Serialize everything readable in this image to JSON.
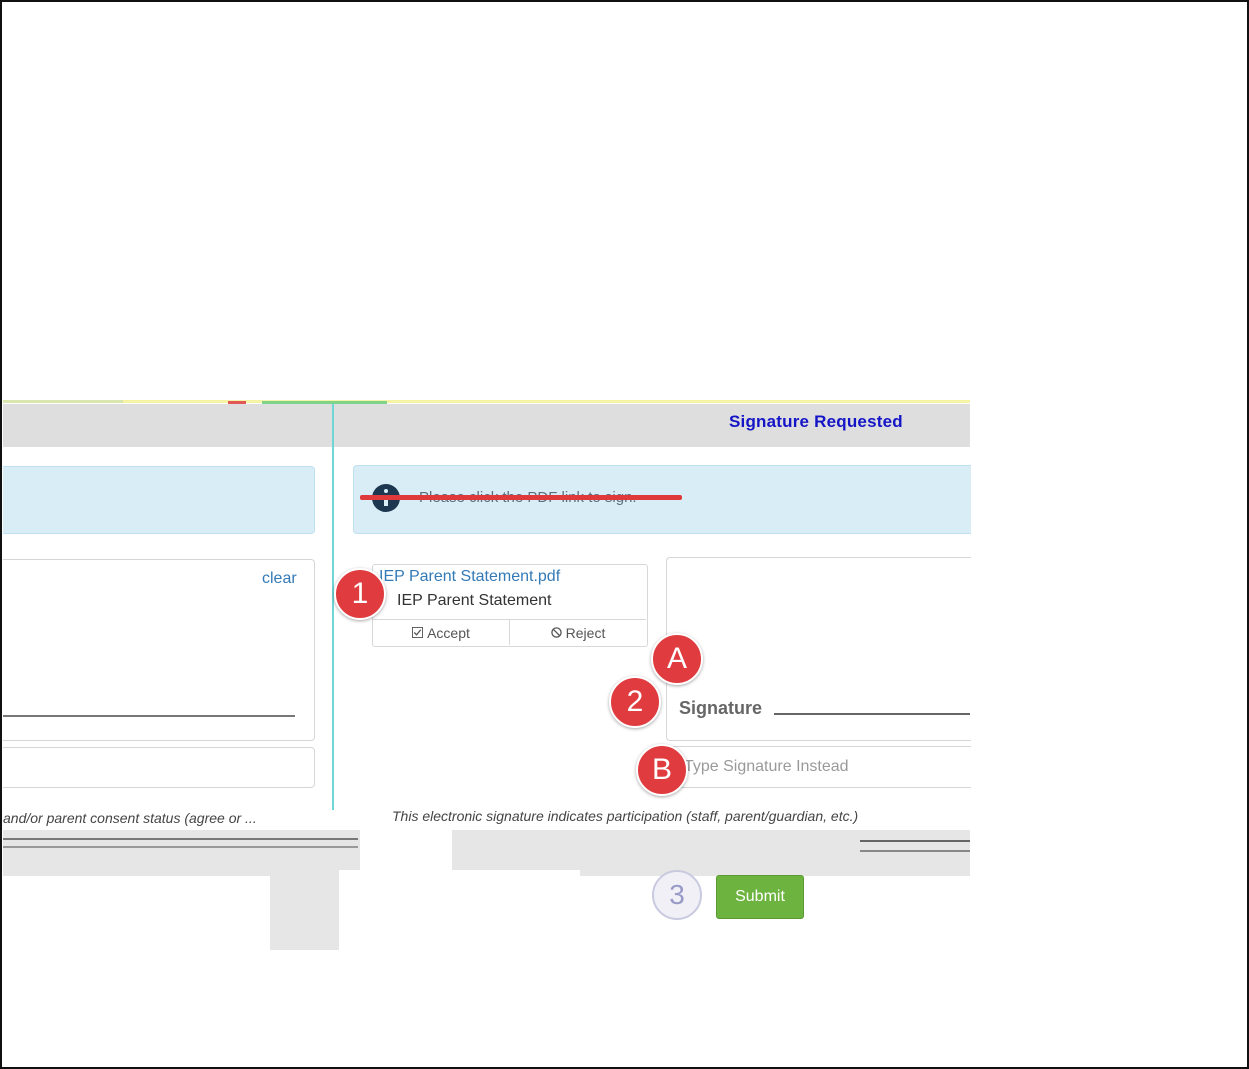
{
  "header": {
    "status": "Signature Requested"
  },
  "info": {
    "message": "Please click the PDF link to sign."
  },
  "left_panel": {
    "clear_label": "clear",
    "disclaimer": "and/or parent consent status (agree or ..."
  },
  "document": {
    "link": "IEP Parent Statement.pdf",
    "title": "IEP Parent Statement",
    "accept_label": "Accept",
    "reject_label": "Reject"
  },
  "signature": {
    "label": "Signature",
    "type_placeholder": "Type Signature Instead"
  },
  "footer": {
    "disclaimer": "This electronic signature indicates participation (staff, parent/guardian, etc.)",
    "submit_label": "Submit"
  },
  "badges": {
    "one": "1",
    "two": "2",
    "three": "3",
    "a": "A",
    "b": "B"
  },
  "colors": {
    "status_text": "#1515c8",
    "info_bg": "#d9edf7",
    "badge_red": "#e03b3e",
    "submit_green": "#6db33f",
    "link_blue": "#337ab7"
  }
}
